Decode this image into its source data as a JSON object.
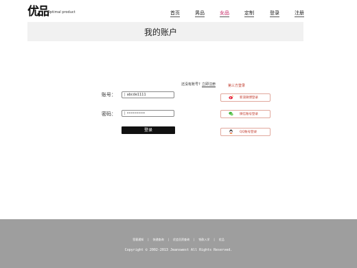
{
  "brand": {
    "name_cn": "优品",
    "name_en": "Optimal product"
  },
  "nav": [
    {
      "label": "首页"
    },
    {
      "label": "男品"
    },
    {
      "label": "女品"
    },
    {
      "label": "定制"
    },
    {
      "label": "登录"
    },
    {
      "label": "注册"
    }
  ],
  "page": {
    "title": "我的账户"
  },
  "login": {
    "no_account_text": "还没有账号?",
    "register_link": "立即注册",
    "account_label": "账号：",
    "account_value": "abcde1111",
    "password_label": "密码：",
    "password_value": "•••••••••",
    "submit_label": "登录"
  },
  "third_party": {
    "title": "第三方登录",
    "buttons": [
      {
        "label": "新浪微博登录",
        "icon": "weibo-icon",
        "color": "#e6162d"
      },
      {
        "label": "微信账号登录",
        "icon": "wechat-icon",
        "color": "#3fb43a"
      },
      {
        "label": "QQ账号登录",
        "icon": "qq-icon",
        "color": "#1a7ee0"
      }
    ]
  },
  "footer": {
    "links": [
      "签客通知",
      "快递查询",
      "优会员资查询",
      "钱款入学",
      "优品"
    ],
    "copyright": "Copyright © 2002-2013 Jeanswest All Rights Reserved."
  },
  "colors": {
    "footer_bg": "#9e9e9e",
    "title_bar_bg": "#f1f1f1",
    "accent": "#c0392b"
  }
}
